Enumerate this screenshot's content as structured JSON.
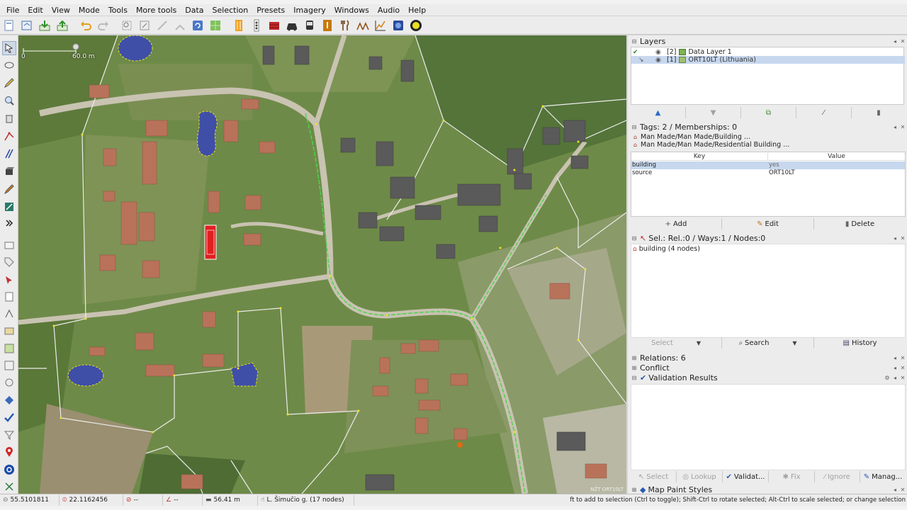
{
  "menu": [
    "File",
    "Edit",
    "View",
    "Mode",
    "Tools",
    "More tools",
    "Data",
    "Selection",
    "Presets",
    "Imagery",
    "Windows",
    "Audio",
    "Help"
  ],
  "map": {
    "scale_zero": "0",
    "scale_label": "60.0 m",
    "attribution": "NŽT ORT10LT"
  },
  "layers_panel": {
    "title": "Layers",
    "layers": [
      {
        "index": "[2]",
        "name": "Data Layer 1"
      },
      {
        "index": "[1]",
        "name": "ORT10LT (Lithuania)"
      }
    ]
  },
  "tags_panel": {
    "title": "Tags: 2 / Memberships: 0",
    "presets": [
      "Man Made/Man Made/Building ...",
      "Man Made/Man Made/Residential Building ..."
    ],
    "col_key": "Key",
    "col_value": "Value",
    "rows": [
      {
        "key": "building",
        "value": "yes"
      },
      {
        "key": "source",
        "value": "ORT10LT"
      }
    ],
    "add": "Add",
    "edit": "Edit",
    "delete": "Delete"
  },
  "selection_panel": {
    "title": "Sel.: Rel.:0 / Ways:1 / Nodes:0",
    "item": "building (4 nodes)",
    "select": "Select",
    "search": "Search",
    "history": "History"
  },
  "relations_panel": {
    "title": "Relations: 6"
  },
  "conflict_panel": {
    "title": "Conflict"
  },
  "validation_panel": {
    "title": "Validation Results",
    "buttons": [
      "Select",
      "Lookup",
      "Validat...",
      "Fix",
      "Ignore",
      "Manag..."
    ]
  },
  "mapstyles_panel": {
    "title": "Map Paint Styles"
  },
  "status": {
    "lat": "55.5101811",
    "lon": "22.1162456",
    "heading": "--",
    "angle": "--",
    "distance": "56.41 m",
    "name": "L. Šimučio g. (17 nodes)",
    "help": "ft to add to selection (Ctrl to toggle); Shift-Ctrl to rotate selected; Alt-Ctrl to scale selected; or change selection"
  },
  "colors": {
    "selected_way": "#e02020",
    "highlight_road": "#4fd34f",
    "building_fill_blue": "#3f4fa8",
    "way_outline": "#e8e8e8",
    "accent_select": "#c7d7ee"
  }
}
